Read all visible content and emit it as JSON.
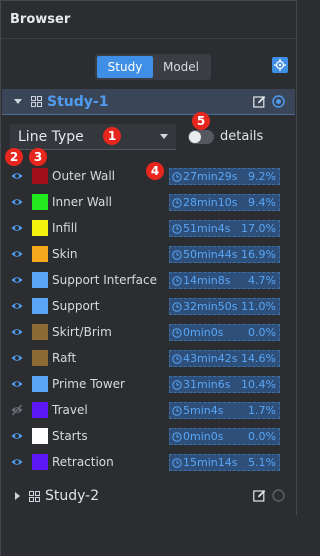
{
  "window": {
    "title": "Browser"
  },
  "tabs": [
    {
      "label": "Study",
      "active": true
    },
    {
      "label": "Model",
      "active": false
    }
  ],
  "study1": {
    "name": "Study-1",
    "expanded": true
  },
  "view_selector": {
    "value": "Line Type"
  },
  "details_toggle": {
    "label": "details",
    "on": false
  },
  "badges": [
    "1",
    "2",
    "3",
    "4",
    "5"
  ],
  "features": [
    {
      "name": "Outer Wall",
      "color": "#a0101a",
      "visible": true,
      "time": "27min29s",
      "percent": "9.2%"
    },
    {
      "name": "Inner Wall",
      "color": "#22e81e",
      "visible": true,
      "time": "28min10s",
      "percent": "9.4%"
    },
    {
      "name": "Infill",
      "color": "#f2f20c",
      "visible": true,
      "time": "51min4s",
      "percent": "17.0%"
    },
    {
      "name": "Skin",
      "color": "#f4a81c",
      "visible": true,
      "time": "50min44s",
      "percent": "16.9%"
    },
    {
      "name": "Support Interface",
      "color": "#5aa6f5",
      "visible": true,
      "time": "14min8s",
      "percent": "4.7%"
    },
    {
      "name": "Support",
      "color": "#5aa6f5",
      "visible": true,
      "time": "32min50s",
      "percent": "11.0%"
    },
    {
      "name": "Skirt/Brim",
      "color": "#8c6a34",
      "visible": true,
      "time": "0min0s",
      "percent": "0.0%"
    },
    {
      "name": "Raft",
      "color": "#8c6a34",
      "visible": true,
      "time": "43min42s",
      "percent": "14.6%"
    },
    {
      "name": "Prime Tower",
      "color": "#5aa6f5",
      "visible": true,
      "time": "31min6s",
      "percent": "10.4%"
    },
    {
      "name": "Travel",
      "color": "#5c18f5",
      "visible": false,
      "time": "5min4s",
      "percent": "1.7%"
    },
    {
      "name": "Starts",
      "color": "#ffffff",
      "visible": true,
      "time": "0min0s",
      "percent": "0.0%"
    },
    {
      "name": "Retraction",
      "color": "#5c18f5",
      "visible": true,
      "time": "15min14s",
      "percent": "5.1%"
    }
  ],
  "study2": {
    "name": "Study-2",
    "expanded": false
  },
  "icons": {
    "locate": "crosshair-icon",
    "group": "group-icon",
    "edit": "edit-icon",
    "active_radio": "radio-checked-icon",
    "inactive_radio": "radio-unchecked-icon",
    "visible": "eye-icon",
    "hidden": "eye-slash-icon",
    "clock": "clock-icon"
  },
  "accent": "#3f8fe6"
}
